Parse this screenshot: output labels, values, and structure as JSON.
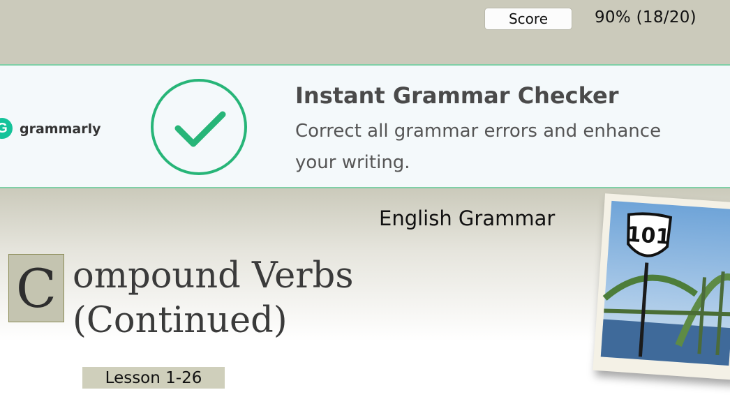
{
  "header": {
    "score_label": "Score",
    "score_value": "90% (18/20)"
  },
  "ad": {
    "brand": "grammarly",
    "logo_letter": "G",
    "title": "Instant Grammar Checker",
    "text": "Correct all grammar errors and enhance your writing.",
    "accent_color": "#15c39a",
    "check_icon": "check-circle-icon"
  },
  "lesson": {
    "subject": "English Grammar",
    "dropcap": "C",
    "title_rest": "ompound Verbs (Continued)",
    "label": "Lesson 1-26",
    "sign_text": "101"
  }
}
